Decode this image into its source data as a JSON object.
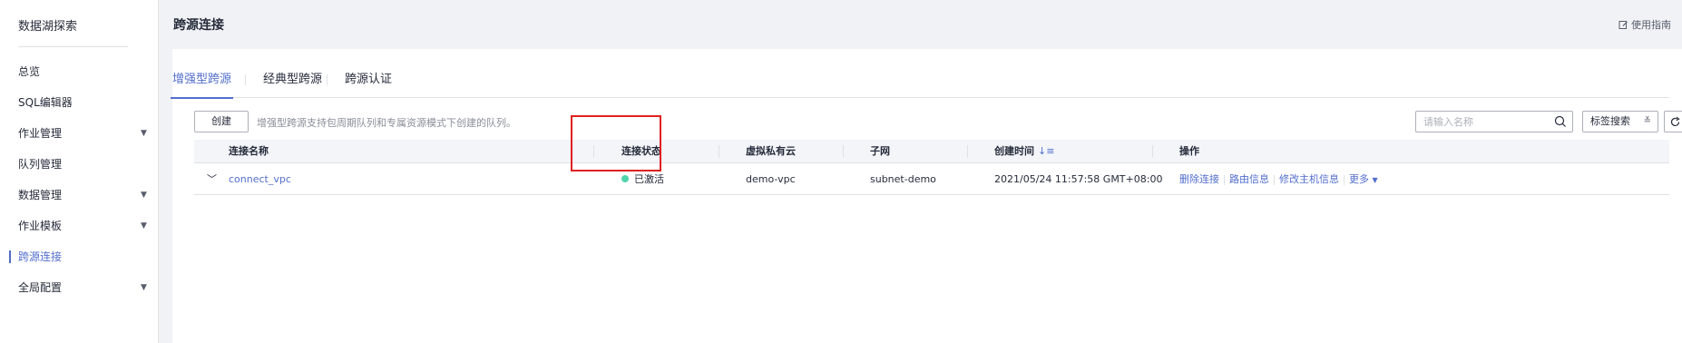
{
  "sidebar": {
    "title": "数据湖探索",
    "items": [
      {
        "label": "总览",
        "expandable": false,
        "active": false
      },
      {
        "label": "SQL编辑器",
        "expandable": false,
        "active": false
      },
      {
        "label": "作业管理",
        "expandable": true,
        "active": false
      },
      {
        "label": "队列管理",
        "expandable": false,
        "active": false
      },
      {
        "label": "数据管理",
        "expandable": true,
        "active": false
      },
      {
        "label": "作业模板",
        "expandable": true,
        "active": false
      },
      {
        "label": "跨源连接",
        "expandable": false,
        "active": true
      },
      {
        "label": "全局配置",
        "expandable": true,
        "active": false
      }
    ]
  },
  "header": {
    "title": "跨源连接",
    "guide_label": "使用指南"
  },
  "tabs": [
    {
      "label": "增强型跨源",
      "active": true
    },
    {
      "label": "经典型跨源",
      "active": false
    },
    {
      "label": "跨源认证",
      "active": false
    }
  ],
  "toolbar": {
    "create_label": "创建",
    "hint": "增强型跨源支持包周期队列和专属资源模式下创建的队列。",
    "search_placeholder": "请输入名称",
    "tag_search_label": "标签搜索"
  },
  "table": {
    "columns": [
      "连接名称",
      "连接状态",
      "虚拟私有云",
      "子网",
      "创建时间",
      "操作"
    ],
    "rows": [
      {
        "name": "connect_vpc",
        "status": "已激活",
        "vpc": "demo-vpc",
        "subnet": "subnet-demo",
        "created": "2021/05/24 11:57:58 GMT+08:00",
        "actions": [
          "删除连接",
          "路由信息",
          "修改主机信息",
          "更多"
        ]
      }
    ]
  },
  "colors": {
    "accent": "#526ecc",
    "status_active": "#50d4ab",
    "highlight": "#e02020"
  }
}
